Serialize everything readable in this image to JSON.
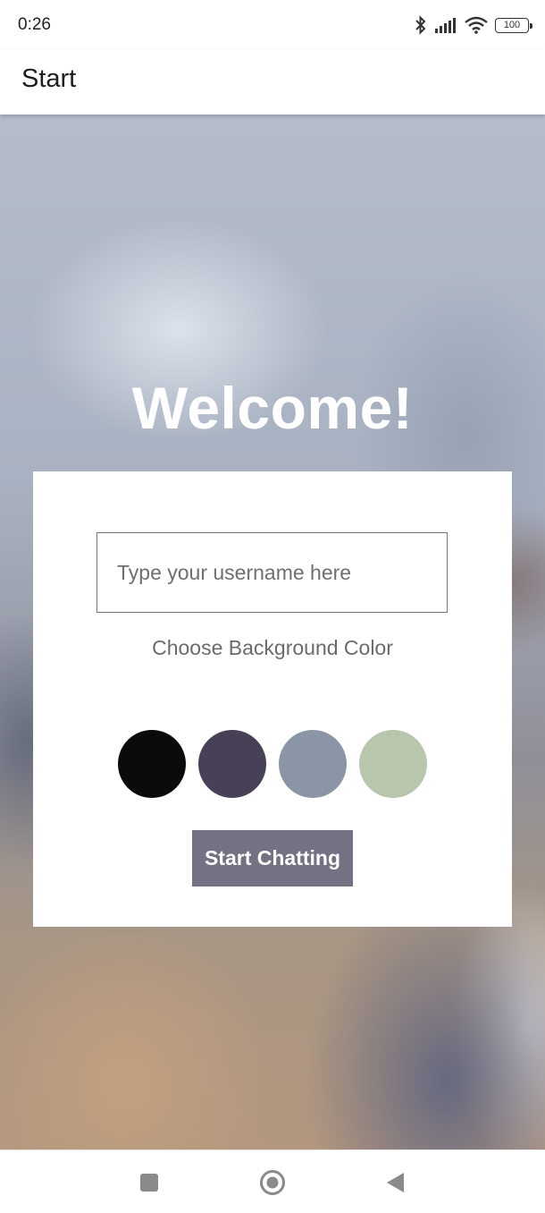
{
  "status_bar": {
    "time": "0:26",
    "icons": [
      "bluetooth-icon",
      "signal-icon",
      "wifi-icon",
      "battery-icon"
    ],
    "battery": "100"
  },
  "app_bar": {
    "title": "Start"
  },
  "main": {
    "welcome": "Welcome!",
    "username_placeholder": "Type your username here",
    "choose_color_label": "Choose Background Color",
    "colors": [
      "#090C08",
      "#474056",
      "#8A95A5",
      "#B9C6AE"
    ],
    "start_button_label": "Start Chatting",
    "start_button_color": "#757083"
  },
  "nav_bar": {
    "icons": [
      "recent-apps-icon",
      "home-icon",
      "back-icon"
    ]
  }
}
